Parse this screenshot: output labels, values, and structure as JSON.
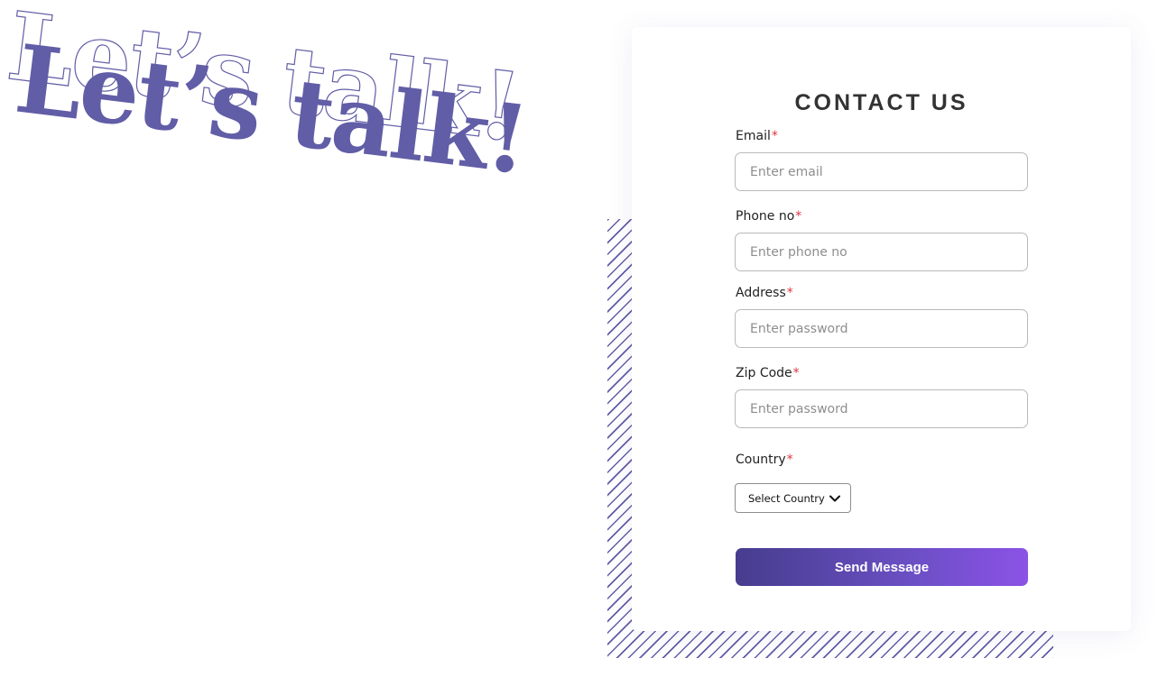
{
  "hero": {
    "headline": "Let’s talk!",
    "color": "#615da6"
  },
  "form": {
    "title": "CONTACT US",
    "required_mark": "*",
    "email": {
      "label": "Email",
      "placeholder": "Enter email"
    },
    "phone": {
      "label": "Phone no",
      "placeholder": "Enter phone no"
    },
    "address": {
      "label": "Address",
      "placeholder": "Enter password"
    },
    "zip": {
      "label": "Zip Code",
      "placeholder": "Enter password"
    },
    "country": {
      "label": "Country",
      "selected": "Select Country",
      "icon": "chevron-down-icon"
    },
    "submit_label": "Send Message"
  },
  "colors": {
    "accent": "#615da6",
    "button_gradient_start": "#463d8d",
    "button_gradient_end": "#8b52e6",
    "required": "#e0343f"
  }
}
